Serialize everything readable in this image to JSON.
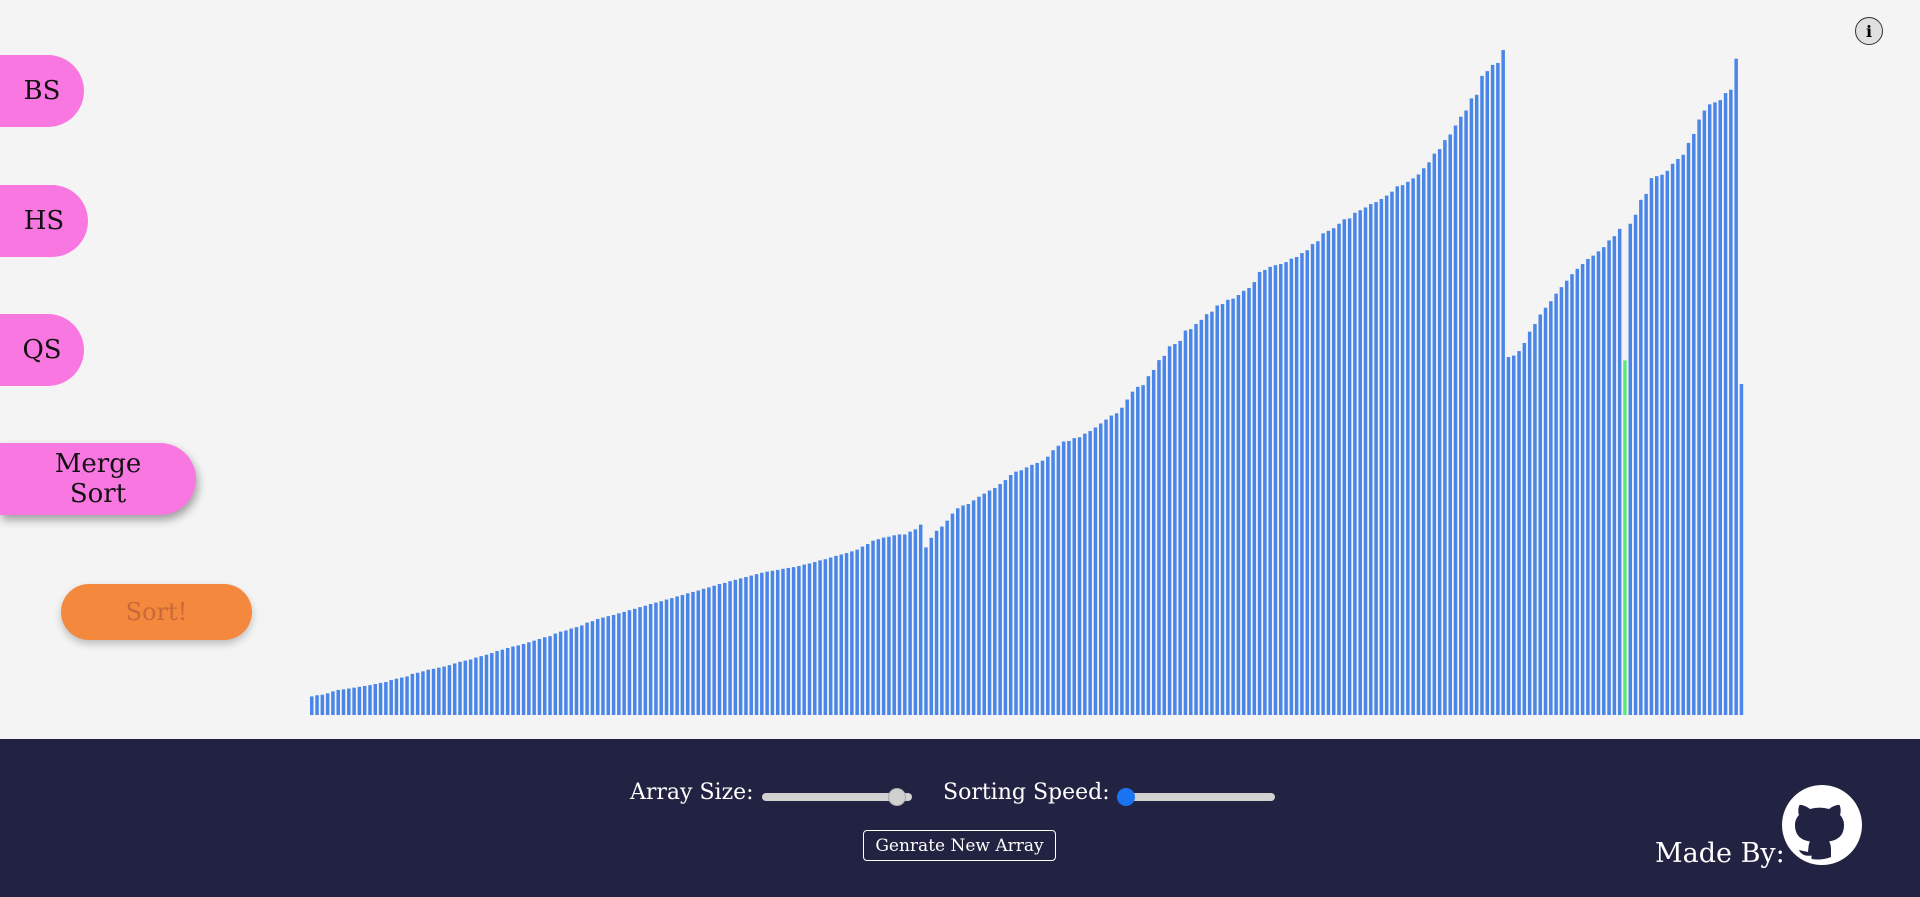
{
  "sidebar": {
    "buttons": [
      {
        "id": "bs",
        "label": "BS"
      },
      {
        "id": "hs",
        "label": "HS"
      },
      {
        "id": "qs",
        "label": "QS"
      },
      {
        "id": "ms",
        "label": "Merge Sort"
      }
    ],
    "sort_label": "Sort!"
  },
  "info": {
    "label": "i"
  },
  "footer": {
    "array_size_label": "Array Size:",
    "sorting_speed_label": "Sorting Speed:",
    "array_size_level": 0.93,
    "sorting_speed_level": 0.0,
    "generate_label": "Genrate New Array",
    "made_by_label": "Made By:",
    "icon": "github-icon"
  },
  "colors": {
    "bar": "#4a86e8",
    "bar_active": "#5de87c",
    "algo_button": "#f977e0",
    "sort_button": "#f4893e",
    "footer_bg": "#222342"
  },
  "chart_data": {
    "type": "bar",
    "series": [
      {
        "values": [
          66,
          70,
          72,
          77,
          84,
          89,
          91,
          94,
          97,
          100,
          103,
          106,
          110,
          114,
          117,
          124,
          129,
          133,
          137,
          146,
          150,
          155,
          161,
          164,
          168,
          172,
          177,
          183,
          189,
          193,
          197,
          204,
          209,
          214,
          220,
          227,
          232,
          238,
          243,
          247,
          252,
          258,
          264,
          270,
          276,
          280,
          289,
          296,
          300,
          307,
          312,
          318,
          328,
          333,
          341,
          346,
          351,
          355,
          361,
          366,
          372,
          377,
          383,
          388,
          394,
          399,
          404,
          410,
          415,
          421,
          426,
          432,
          437,
          442,
          448,
          453,
          459,
          465,
          469,
          475,
          480,
          485,
          490,
          495,
          500,
          505,
          509,
          512,
          515,
          519,
          522,
          525,
          529,
          534,
          538,
          543,
          549,
          553,
          559,
          565,
          570,
          575,
          581,
          587,
          598,
          607,
          619,
          624,
          630,
          633,
          638,
          641,
          641,
          651,
          659,
          676,
          595,
          629,
          654,
          669,
          690,
          715,
          734,
          744,
          749,
          762,
          775,
          786,
          797,
          806,
          820,
          834,
          852,
          864,
          869,
          879,
          888,
          895,
          903,
          917,
          940,
          956,
          971,
          973,
          983,
          986,
          999,
          1008,
          1021,
          1035,
          1049,
          1063,
          1071,
          1091,
          1120,
          1148,
          1165,
          1171,
          1203,
          1225,
          1260,
          1275,
          1309,
          1317,
          1328,
          1365,
          1370,
          1388,
          1403,
          1423,
          1432,
          1454,
          1459,
          1474,
          1478,
          1491,
          1506,
          1516,
          1537,
          1573,
          1580,
          1591,
          1597,
          1601,
          1608,
          1620,
          1626,
          1640,
          1650,
          1672,
          1682,
          1710,
          1719,
          1728,
          1744,
          1760,
          1763,
          1783,
          1792,
          1802,
          1814,
          1821,
          1832,
          1844,
          1858,
          1877,
          1881,
          1893,
          1905,
          1919,
          1941,
          1962,
          1993,
          2009,
          2041,
          2061,
          2093,
          2124,
          2146,
          2189,
          2202,
          2269,
          2286,
          2308,
          2315,
          2361
        ]
      },
      {
        "values": [
          1271,
          1276,
          1292,
          1321,
          1361,
          1388,
          1422,
          1446,
          1469,
          1496,
          1519,
          1542,
          1565,
          1584,
          1601,
          1619,
          1631,
          1646,
          1661,
          1685,
          1700,
          1726,
          1744,
          1776,
          1829,
          1850,
          1906,
          1913,
          1918,
          1932,
          1957,
          1974,
          1989,
          2031,
          2063,
          2114,
          2146,
          2168,
          2175,
          2183,
          2208,
          2220,
          2330
        ]
      }
    ],
    "active_indices": [
      1249,
      1327
    ],
    "highlighted_values": [
      1259,
      1175
    ]
  }
}
